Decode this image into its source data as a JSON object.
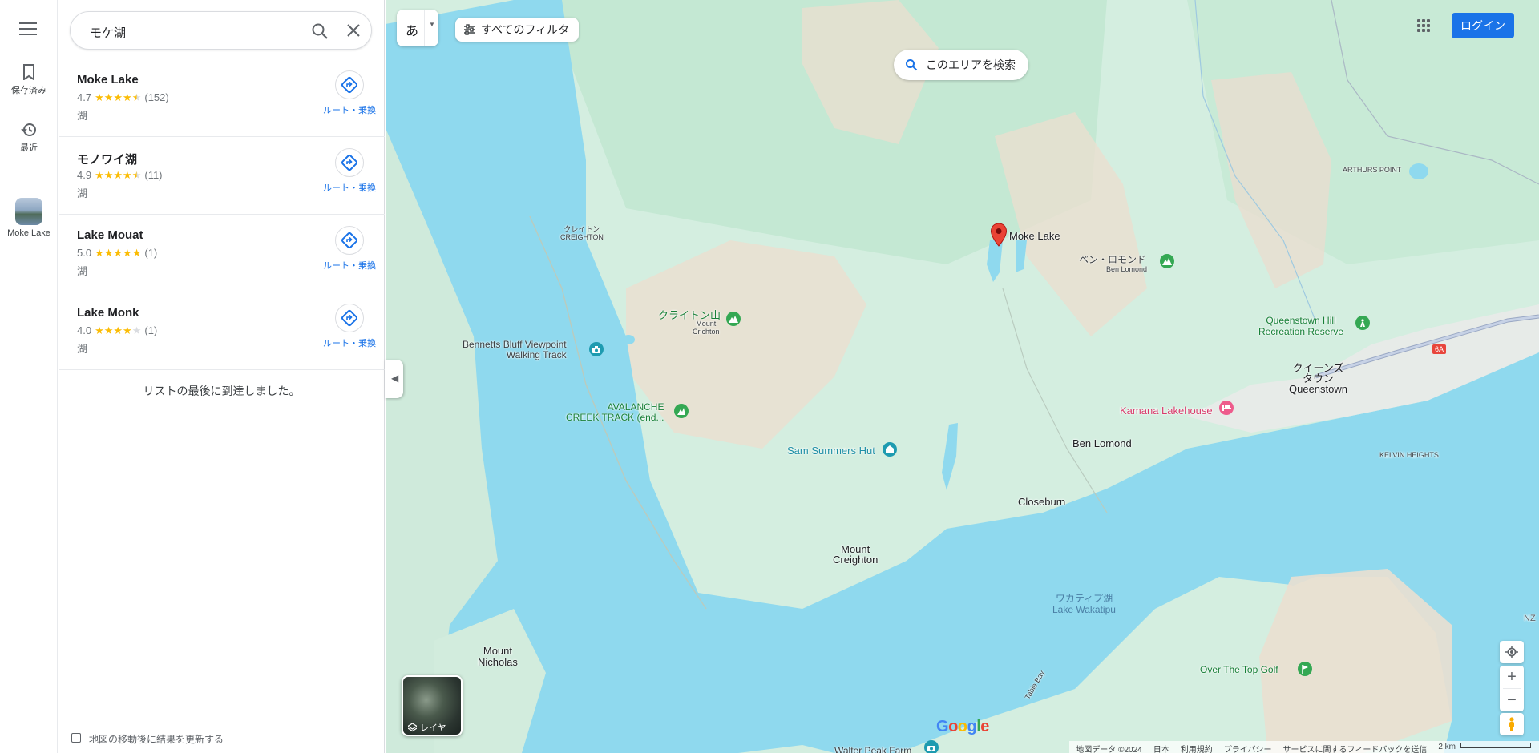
{
  "rail": {
    "saved_label": "保存済み",
    "recent_label": "最近",
    "recent_place_label": "Moke Lake"
  },
  "search": {
    "query": "モケ湖",
    "search_icon": "search-icon",
    "clear_icon": "close-icon"
  },
  "results": [
    {
      "name": "Moke Lake",
      "rating": "4.7",
      "stars": 4.7,
      "reviews": "(152)",
      "type": "湖",
      "route_label": "ルート・乗換"
    },
    {
      "name": "モノワイ湖",
      "rating": "4.9",
      "stars": 4.9,
      "reviews": "(11)",
      "type": "湖",
      "route_label": "ルート・乗換"
    },
    {
      "name": "Lake Mouat",
      "rating": "5.0",
      "stars": 5.0,
      "reviews": "(1)",
      "type": "湖",
      "route_label": "ルート・乗換"
    },
    {
      "name": "Lake Monk",
      "rating": "4.0",
      "stars": 4.0,
      "reviews": "(1)",
      "type": "湖",
      "route_label": "ルート・乗換"
    }
  ],
  "end_of_list": "リストの最後に到達しました。",
  "update_on_move_label": "地図の移動後に結果を更新する",
  "map": {
    "lang_button": "あ",
    "filters_label": "すべてのフィルタ",
    "search_area_label": "このエリアを検索",
    "login_label": "ログイン",
    "layers_label": "レイヤ",
    "google_logo": "Google",
    "labels": {
      "moke_lake": "Moke Lake",
      "ben_lomond_jp": "ベン・ロモンド",
      "ben_lomond_en": "Ben Lomond",
      "ben_lomond_area": "Ben Lomond",
      "creighton_jp": "クレイトン",
      "creighton_en": "CREIGHTON",
      "mt_creighton_jp": "クライトン山",
      "mt_creighton_en_1": "Mount",
      "mt_creighton_en_2": "Crichton",
      "bennetts_1": "Bennetts Bluff Viewpoint",
      "bennetts_2": "Walking Track",
      "avalanche_1": "AVALANCHE",
      "avalanche_2": "CREEK TRACK (end...",
      "sam_summers": "Sam Summers Hut",
      "queenstown_hill_1": "Queenstown Hill",
      "queenstown_hill_2": "Recreation Reserve",
      "queenstown_jp_1": "クイーンズ",
      "queenstown_jp_2": "タウン",
      "queenstown_en": "Queenstown",
      "kamana": "Kamana Lakehouse",
      "arthurs_point": "ARTHURS POINT",
      "kelvin_heights": "KELVIN HEIGHTS",
      "closeburn": "Closeburn",
      "mount_creighton_1": "Mount",
      "mount_creighton_2": "Creighton",
      "wakatipu_jp": "ワカティプ湖",
      "wakatipu_en": "Lake Wakatipu",
      "mount_nicholas_1": "Mount",
      "mount_nicholas_2": "Nicholas",
      "over_the_top": "Over The Top Golf",
      "walter_peak": "Walter Peak Farm",
      "table_bay": "Table Bay",
      "route_6a": "6A",
      "nz": "NZ"
    },
    "attribution": {
      "map_data": "地図データ ©2024",
      "country": "日本",
      "terms": "利用規約",
      "privacy": "プライバシー",
      "feedback": "サービスに関するフィードバックを送信",
      "scale": "2 km"
    },
    "colors": {
      "water": "#8fd9ee",
      "land": "#d4eee0",
      "forest": "#bfe6cf",
      "bare": "#efe3d6",
      "accent": "#1a73e8",
      "pin": "#ea4335"
    }
  }
}
